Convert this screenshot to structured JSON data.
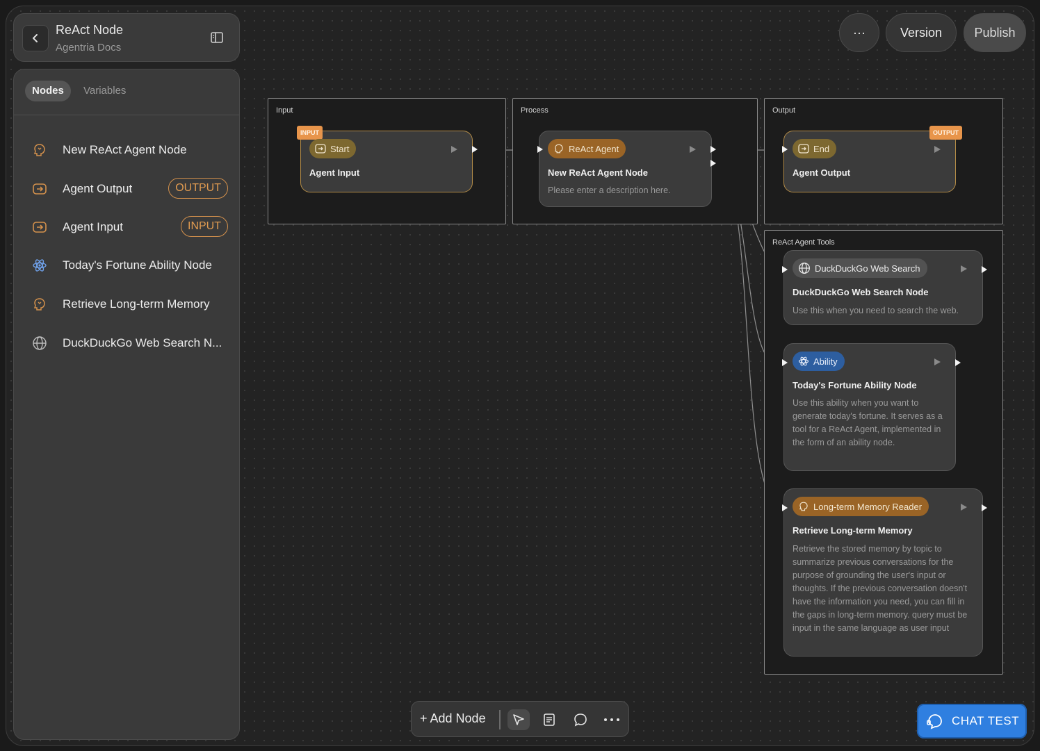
{
  "header": {
    "title": "ReAct Node",
    "subtitle": "Agentria Docs",
    "back_icon": "chevron-left-icon",
    "toggle_icon": "sidebar-toggle-icon"
  },
  "sidebar": {
    "tabs": [
      {
        "label": "Nodes",
        "active": true
      },
      {
        "label": "Variables",
        "active": false
      }
    ],
    "items": [
      {
        "label": "New ReAct Agent Node",
        "icon": "brain-icon",
        "badge": ""
      },
      {
        "label": "Agent Output",
        "icon": "login-box-icon",
        "badge": "OUTPUT"
      },
      {
        "label": "Agent Input",
        "icon": "login-box-icon",
        "badge": "INPUT"
      },
      {
        "label": "Today's Fortune Ability Node",
        "icon": "atom-icon",
        "badge": ""
      },
      {
        "label": "Retrieve Long-term Memory",
        "icon": "brain-icon",
        "badge": ""
      },
      {
        "label": "DuckDuckGo Web Search N...",
        "icon": "globe-icon",
        "badge": ""
      }
    ]
  },
  "topbar": {
    "more_label": "···",
    "version_label": "Version",
    "publish_label": "Publish"
  },
  "canvas": {
    "groups": {
      "input": "Input",
      "process": "Process",
      "output": "Output",
      "tools": "ReAct Agent Tools"
    },
    "nodes": {
      "start": {
        "tag": "INPUT",
        "badge": "Start",
        "title": "Agent Input"
      },
      "react": {
        "badge": "ReAct Agent",
        "title": "New ReAct Agent Node",
        "desc": "Please enter a description here."
      },
      "end": {
        "tag": "OUTPUT",
        "badge": "End",
        "title": "Agent Output"
      },
      "ddg": {
        "badge": "DuckDuckGo Web Search",
        "title": "DuckDuckGo Web Search Node",
        "desc": "Use this when you need to search the web."
      },
      "ability": {
        "badge": "Ability",
        "title": "Today's Fortune Ability Node",
        "desc": "Use this ability when you want to generate today's fortune. It serves as a tool for a ReAct Agent, implemented in the form of an ability node."
      },
      "memory": {
        "badge": "Long-term Memory Reader",
        "title": "Retrieve Long-term Memory",
        "desc": "Retrieve the stored memory by topic to summarize previous conversations for the purpose of grounding the user's input or thoughts. If the previous conversation doesn't have the information you need, you can fill in the gaps in long-term memory. query must be input in the same language as user input"
      }
    }
  },
  "bottombar": {
    "add_node_label": "+ Add Node",
    "icons": [
      "pointer-icon",
      "note-icon",
      "comment-icon",
      "more-icon"
    ]
  },
  "chat": {
    "label": "CHAT TEST",
    "icon": "chat-headset-icon"
  },
  "colors": {
    "accent_orange": "#e8954b",
    "gold_border": "#b28b47",
    "ability_blue": "#2d5ea0",
    "chat_blue": "#2f7fe0"
  }
}
